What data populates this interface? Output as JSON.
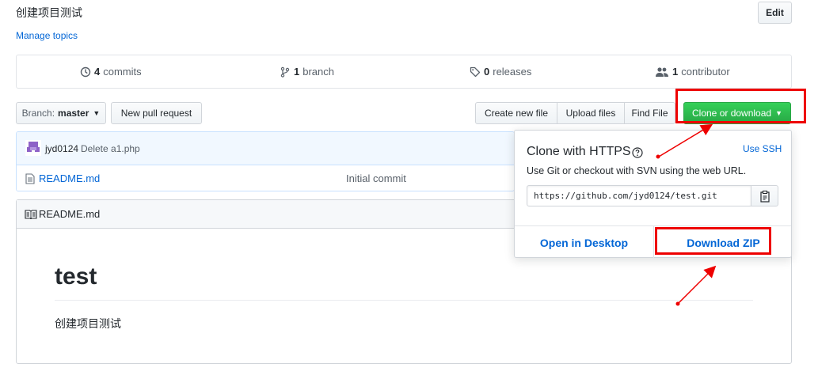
{
  "repo": {
    "description": "创建项目测试",
    "manage_topics": "Manage topics",
    "edit_label": "Edit"
  },
  "summary": {
    "commits": {
      "count": "4",
      "label": "commits"
    },
    "branches": {
      "count": "1",
      "label": "branch"
    },
    "releases": {
      "count": "0",
      "label": "releases"
    },
    "contributors": {
      "count": "1",
      "label": "contributor"
    }
  },
  "toolbar": {
    "branch_prefix": "Branch:",
    "branch_name": "master",
    "new_pull_request": "New pull request",
    "create_new_file": "Create new file",
    "upload_files": "Upload files",
    "find_file": "Find File",
    "clone_or_download": "Clone or download"
  },
  "latest_commit": {
    "author": "jyd0124",
    "message": "Delete a1.php"
  },
  "files": [
    {
      "name": "README.md",
      "commit_message": "Initial commit"
    }
  ],
  "readme": {
    "filename": "README.md",
    "heading": "test",
    "body": "创建项目测试"
  },
  "clone_popup": {
    "title": "Clone with HTTPS",
    "help_icon": "question-icon",
    "use_ssh": "Use SSH",
    "description": "Use Git or checkout with SVN using the web URL.",
    "url": "https://github.com/jyd0124/test.git",
    "open_in_desktop": "Open in Desktop",
    "download_zip": "Download ZIP"
  },
  "colors": {
    "link": "#0366d6",
    "green_button": "#28a745",
    "annotation_red": "#e00000",
    "avatar": "#8e61c7"
  }
}
